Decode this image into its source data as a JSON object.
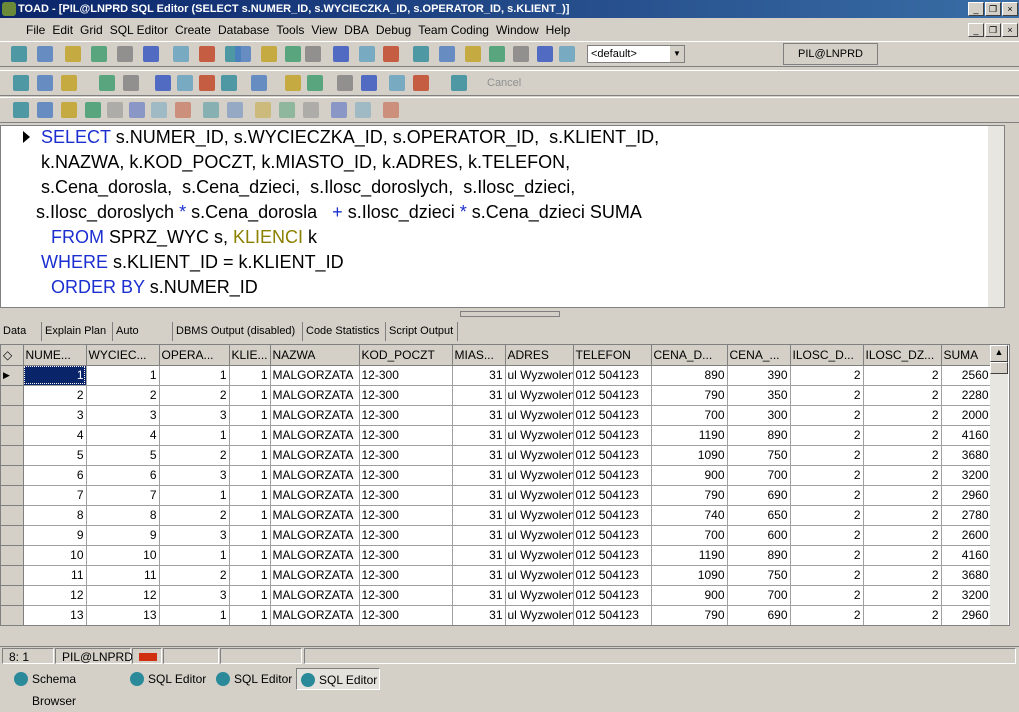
{
  "window": {
    "title": "TOAD - [PIL@LNPRD SQL Editor (SELECT s.NUMER_ID, s.WYCIECZKA_ID, s.OPERATOR_ID,  s.KLIENT_)]"
  },
  "menu": [
    "File",
    "Edit",
    "Grid",
    "SQL Editor",
    "Create",
    "Database",
    "Tools",
    "View",
    "DBA",
    "Debug",
    "Team Coding",
    "Window",
    "Help"
  ],
  "toolbar": {
    "schema_select": "<default>",
    "connection": "PIL@LNPRD",
    "cancel": "Cancel"
  },
  "sql": [
    [
      [
        "kw",
        "SELECT "
      ],
      [
        "",
        "s.NUMER_ID, s.WYCIECZKA_ID, s.OPERATOR_ID,  s.KLIENT_ID,"
      ]
    ],
    [
      [
        "",
        "k.NAZWA, k.KOD_POCZT, k.MIASTO_ID, k.ADRES, k.TELEFON,"
      ]
    ],
    [
      [
        "",
        "s.Cena_dorosla,  s.Cena_dzieci,  s.Ilosc_doroslych,  s.Ilosc_dzieci,"
      ]
    ],
    [
      [
        "",
        "s.Ilosc_doroslych "
      ],
      [
        "kw",
        "* "
      ],
      [
        "",
        "s.Cena_dorosla   "
      ],
      [
        "kw",
        "+ "
      ],
      [
        "",
        "s.Ilosc_dzieci "
      ],
      [
        "kw",
        "* "
      ],
      [
        "",
        "s.Cena_dzieci SUMA"
      ]
    ],
    [
      [
        "kw",
        " FROM "
      ],
      [
        "",
        "SPRZ_WYC s, "
      ],
      [
        "tbl",
        "KLIENCI"
      ],
      [
        "",
        " k"
      ]
    ],
    [
      [
        "kw",
        "WHERE "
      ],
      [
        "",
        "s.KLIENT_ID = k.KLIENT_ID"
      ]
    ],
    [
      [
        "kw",
        " ORDER BY "
      ],
      [
        "",
        "s.NUMER_ID"
      ]
    ]
  ],
  "result_tabs": [
    "Data",
    "Explain Plan",
    "Auto Trace",
    "DBMS Output (disabled)",
    "Code Statistics",
    "Script Output"
  ],
  "grid": {
    "columns": [
      "NUME...",
      "WYCIEC...",
      "OPERA...",
      "KLIE...",
      "NAZWA",
      "KOD_POCZT",
      "MIAS...",
      "ADRES",
      "TELEFON",
      "CENA_D...",
      "CENA_...",
      "ILOSC_D...",
      "ILOSC_DZ...",
      "SUMA"
    ],
    "rows": [
      [
        "1",
        "1",
        "1",
        "1",
        "MALGORZATA",
        "12-300",
        "31",
        "ul Wyzwolenia",
        "012 504123",
        "890",
        "390",
        "2",
        "2",
        "2560"
      ],
      [
        "2",
        "2",
        "2",
        "1",
        "MALGORZATA",
        "12-300",
        "31",
        "ul Wyzwolenia",
        "012 504123",
        "790",
        "350",
        "2",
        "2",
        "2280"
      ],
      [
        "3",
        "3",
        "3",
        "1",
        "MALGORZATA",
        "12-300",
        "31",
        "ul Wyzwolenia",
        "012 504123",
        "700",
        "300",
        "2",
        "2",
        "2000"
      ],
      [
        "4",
        "4",
        "1",
        "1",
        "MALGORZATA",
        "12-300",
        "31",
        "ul Wyzwolenia",
        "012 504123",
        "1190",
        "890",
        "2",
        "2",
        "4160"
      ],
      [
        "5",
        "5",
        "2",
        "1",
        "MALGORZATA",
        "12-300",
        "31",
        "ul Wyzwolenia",
        "012 504123",
        "1090",
        "750",
        "2",
        "2",
        "3680"
      ],
      [
        "6",
        "6",
        "3",
        "1",
        "MALGORZATA",
        "12-300",
        "31",
        "ul Wyzwolenia",
        "012 504123",
        "900",
        "700",
        "2",
        "2",
        "3200"
      ],
      [
        "7",
        "7",
        "1",
        "1",
        "MALGORZATA",
        "12-300",
        "31",
        "ul Wyzwolenia",
        "012 504123",
        "790",
        "690",
        "2",
        "2",
        "2960"
      ],
      [
        "8",
        "8",
        "2",
        "1",
        "MALGORZATA",
        "12-300",
        "31",
        "ul Wyzwolenia",
        "012 504123",
        "740",
        "650",
        "2",
        "2",
        "2780"
      ],
      [
        "9",
        "9",
        "3",
        "1",
        "MALGORZATA",
        "12-300",
        "31",
        "ul Wyzwolenia",
        "012 504123",
        "700",
        "600",
        "2",
        "2",
        "2600"
      ],
      [
        "10",
        "10",
        "1",
        "1",
        "MALGORZATA",
        "12-300",
        "31",
        "ul Wyzwolenia",
        "012 504123",
        "1190",
        "890",
        "2",
        "2",
        "4160"
      ],
      [
        "11",
        "11",
        "2",
        "1",
        "MALGORZATA",
        "12-300",
        "31",
        "ul Wyzwolenia",
        "012 504123",
        "1090",
        "750",
        "2",
        "2",
        "3680"
      ],
      [
        "12",
        "12",
        "3",
        "1",
        "MALGORZATA",
        "12-300",
        "31",
        "ul Wyzwolenia",
        "012 504123",
        "900",
        "700",
        "2",
        "2",
        "3200"
      ],
      [
        "13",
        "13",
        "1",
        "1",
        "MALGORZATA",
        "12-300",
        "31",
        "ul Wyzwolenia",
        "012 504123",
        "790",
        "690",
        "2",
        "2",
        "2960"
      ]
    ]
  },
  "status": {
    "position": "8:  1",
    "connection": "PIL@LNPRD"
  },
  "taskbar": [
    "Schema Browser",
    "SQL Editor",
    "SQL Editor",
    "SQL Editor"
  ]
}
